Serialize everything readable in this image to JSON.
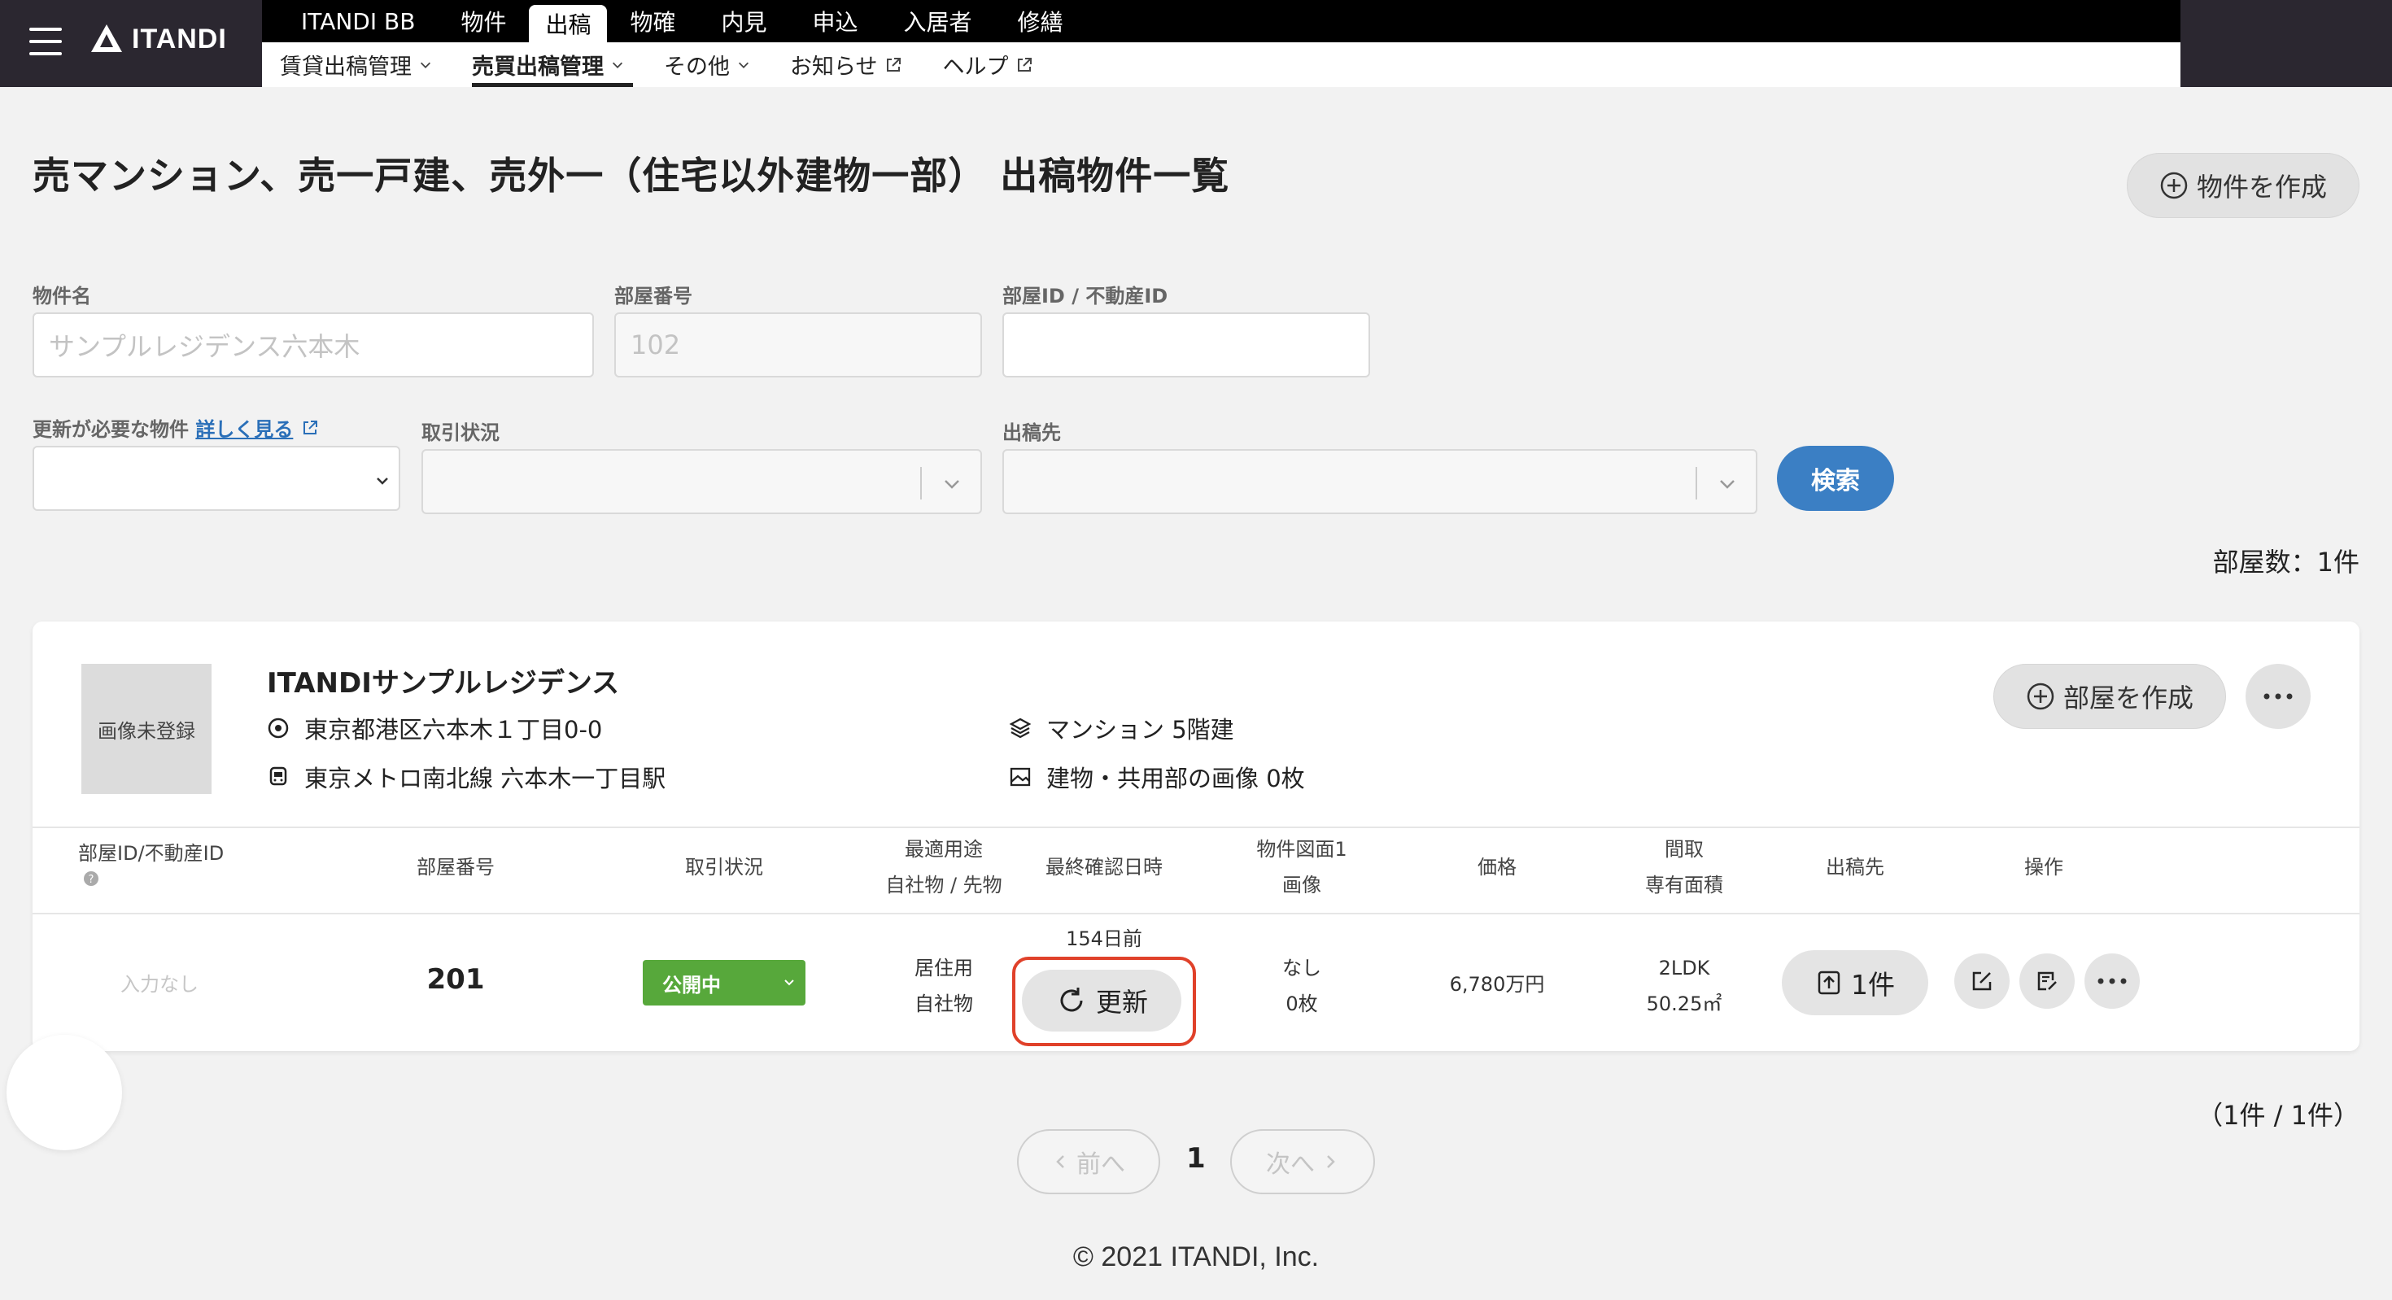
{
  "header": {
    "logo_text": "ITANDI",
    "main_nav": [
      "ITANDI BB",
      "物件",
      "出稿",
      "物確",
      "内見",
      "申込",
      "入居者",
      "修繕"
    ],
    "main_nav_active": "出稿",
    "sub_nav": {
      "rent": "賃貸出稿管理",
      "sale": "売買出稿管理",
      "other": "その他",
      "news": "お知らせ",
      "help": "ヘルプ"
    }
  },
  "page": {
    "title": "売マンション、売一戸建、売外一（住宅以外建物一部） 出稿物件一覧",
    "create_property_label": "物件を作成",
    "room_count_text": "部屋数：1件",
    "page_range_text": "（1件 / 1件）"
  },
  "search": {
    "property_name_label": "物件名",
    "property_name_placeholder": "サンプルレジデンス六本木",
    "room_number_label": "部屋番号",
    "room_number_placeholder": "102",
    "room_id_label": "部屋ID / 不動産ID",
    "needs_update_label": "更新が必要な物件",
    "details_link": "詳しく見る",
    "transaction_status_label": "取引状況",
    "destination_label": "出稿先",
    "search_button": "検索"
  },
  "property": {
    "image_placeholder": "画像未登録",
    "name": "ITANDIサンプルレジデンス",
    "address": "東京都港区六本木１丁目0-0",
    "station": "東京メトロ南北線 六本木一丁目駅",
    "building_type": "マンション 5階建",
    "common_images": "建物・共用部の画像 0枚",
    "create_room_label": "部屋を作成"
  },
  "table": {
    "headers": {
      "room_id": "部屋ID/不動産ID",
      "room_number": "部屋番号",
      "status": "取引状況",
      "usage_1": "最適用途",
      "usage_2": "自社物 / 先物",
      "last_confirmed": "最終確認日時",
      "floorplan_1": "物件図面1",
      "floorplan_2": "画像",
      "price": "価格",
      "layout_1": "間取",
      "layout_2": "専有面積",
      "destination": "出稿先",
      "operation": "操作"
    },
    "row": {
      "room_id": "入力なし",
      "room_number": "201",
      "status": "公開中",
      "usage": "居住用",
      "ownership": "自社物",
      "days_ago": "154日前",
      "update_button": "更新",
      "floorplan": "なし",
      "images": "0枚",
      "price": "6,780万円",
      "layout": "2LDK",
      "area": "50.25㎡",
      "destination_count": "1件"
    }
  },
  "pagination": {
    "prev": "前へ",
    "current": "1",
    "next": "次へ"
  },
  "footer": {
    "copyright": "© 2021 ITANDI, Inc."
  },
  "colors": {
    "topbar": "#2b2730",
    "accent_blue": "#3b7fc4",
    "status_green": "#57a83b",
    "highlight_red": "#e0412a"
  }
}
